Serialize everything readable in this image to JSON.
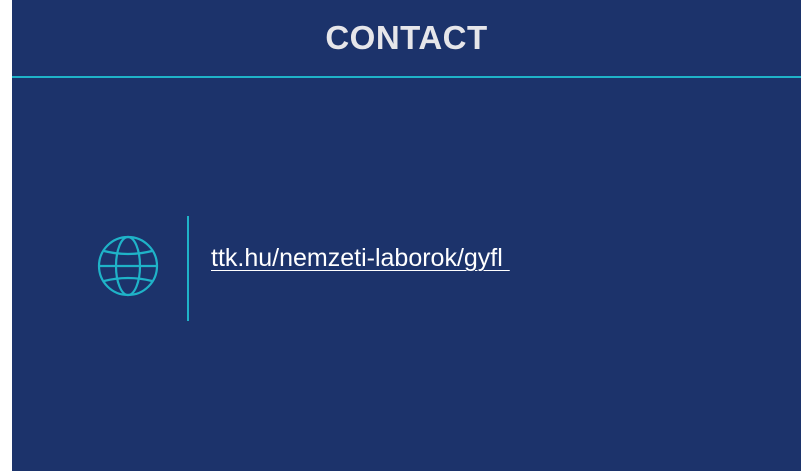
{
  "slide": {
    "title": "CONTACT",
    "icon": "globe-icon",
    "website_link": "ttk.hu/nemzeti-laborok/gyfl ",
    "colors": {
      "background": "#1c336b",
      "accent": "#1fb3c8",
      "text": "#ffffff"
    }
  }
}
